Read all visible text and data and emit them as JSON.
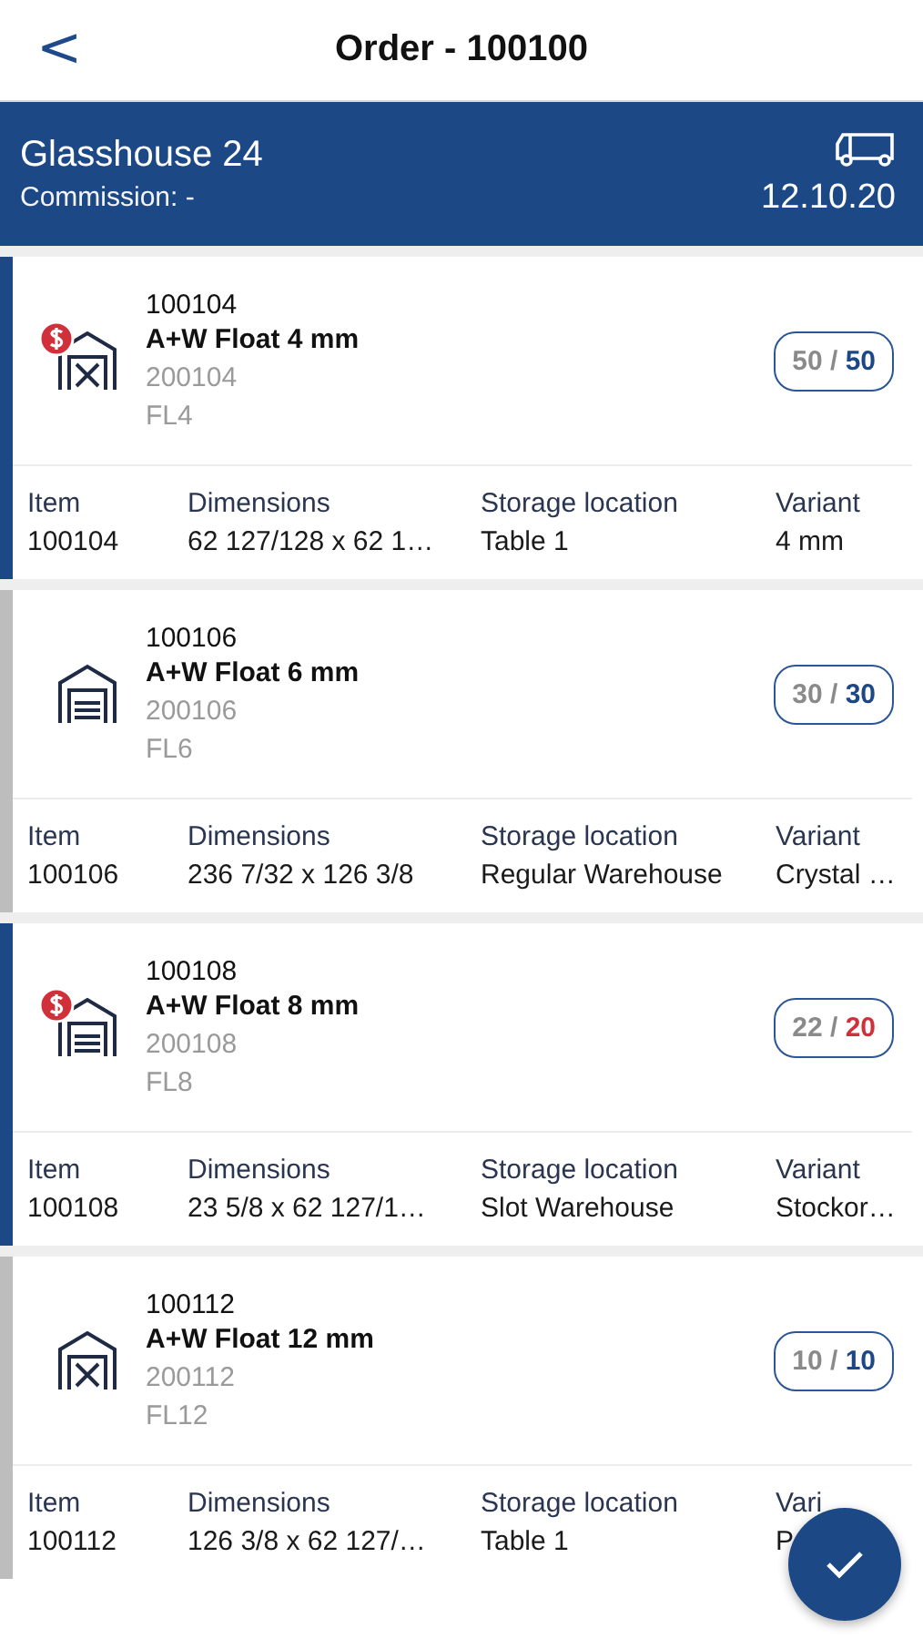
{
  "nav": {
    "back": "<",
    "title": "Order - 100100"
  },
  "header": {
    "customer": "Glasshouse 24",
    "commission": "Commission: -",
    "date": "12.10.20"
  },
  "items": [
    {
      "number": "100104",
      "name": "A+W Float 4 mm",
      "code": "200104",
      "short": "FL4",
      "flagged": true,
      "kind": "tools",
      "picked": "50 /",
      "required": "50",
      "over": false,
      "labels": [
        "Item",
        "Dimensions",
        "Storage location",
        "Variant"
      ],
      "values": [
        "100104",
        "62 127/128 x 62 1…",
        "Table 1",
        "4 mm"
      ]
    },
    {
      "number": "100106",
      "name": "A+W Float 6 mm",
      "code": "200106",
      "short": "FL6",
      "flagged": false,
      "kind": "garage",
      "picked": "30 /",
      "required": "30",
      "over": false,
      "labels": [
        "Item",
        "Dimensions",
        "Storage location",
        "Variant"
      ],
      "values": [
        "100106",
        "236 7/32 x 126 3/8",
        "Regular Warehouse",
        "Crystal …"
      ]
    },
    {
      "number": "100108",
      "name": "A+W Float 8 mm",
      "code": "200108",
      "short": "FL8",
      "flagged": true,
      "kind": "garage",
      "picked": "22 /",
      "required": "20",
      "over": true,
      "labels": [
        "Item",
        "Dimensions",
        "Storage location",
        "Variant"
      ],
      "values": [
        "100108",
        "23 5/8 x 62 127/1…",
        "Slot Warehouse",
        "Stockor…"
      ]
    },
    {
      "number": "100112",
      "name": "A+W Float 12 mm",
      "code": "200112",
      "short": "FL12",
      "flagged": false,
      "kind": "tools",
      "picked": "10 /",
      "required": "10",
      "over": false,
      "labels": [
        "Item",
        "Dimensions",
        "Storage location",
        "Vari"
      ],
      "values": [
        "100112",
        "126 3/8 x 62 127/…",
        "Table 1",
        "P"
      ]
    }
  ]
}
